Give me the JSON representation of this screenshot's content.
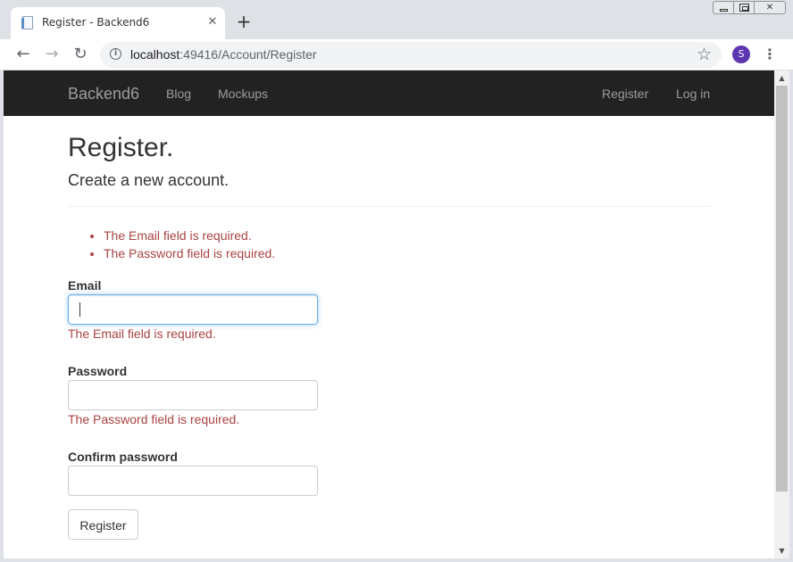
{
  "browser": {
    "tab_title": "Register - Backend6",
    "tab_close": "✕",
    "new_tab": "+",
    "url_host": "localhost",
    "url_path": ":49416/Account/Register",
    "profile_initial": "S",
    "info_glyph": "i",
    "star_glyph": "☆",
    "menu_glyph": "⋮",
    "back_glyph": "←",
    "forward_glyph": "→",
    "reload_glyph": "↻",
    "icons": [
      "page-favicon",
      "close-icon",
      "plus-icon",
      "back-arrow-icon",
      "forward-arrow-icon",
      "reload-icon",
      "info-icon",
      "star-icon",
      "profile-avatar",
      "menu-dots-icon"
    ]
  },
  "navbar": {
    "brand": "Backend6",
    "left_links": [
      "Blog",
      "Mockups"
    ],
    "right_links": [
      "Register",
      "Log in"
    ]
  },
  "page": {
    "title": "Register.",
    "subtitle": "Create a new account.",
    "validation_summary": [
      "The Email field is required.",
      "The Password field is required."
    ],
    "fields": {
      "email": {
        "label": "Email",
        "value": "",
        "error": "The Email field is required."
      },
      "password": {
        "label": "Password",
        "value": "",
        "error": "The Password field is required."
      },
      "confirm_password": {
        "label": "Confirm password",
        "value": ""
      }
    },
    "submit_label": "Register"
  },
  "colors": {
    "navbar_bg": "#222222",
    "navbar_text": "#9d9d9d",
    "error_text": "#a94442",
    "focus_border": "#66afe9",
    "profile_bg": "#5e35b1"
  }
}
